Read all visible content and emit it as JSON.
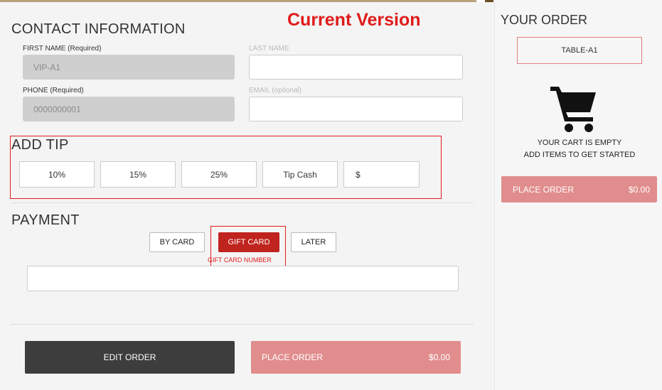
{
  "banner": {
    "version_label": "Current Version"
  },
  "contact": {
    "title": "CONTACT INFORMATION",
    "first_name": {
      "label": "FIRST NAME (Required)",
      "value": "VIP-A1"
    },
    "last_name": {
      "label": "LAST NAME",
      "value": ""
    },
    "phone": {
      "label": "PHONE (Required)",
      "value": "0000000001"
    },
    "email": {
      "label": "EMAIL (optional)",
      "value": ""
    }
  },
  "tip": {
    "title": "ADD TIP",
    "options": [
      "10%",
      "15%",
      "25%",
      "Tip Cash"
    ],
    "amount_prefix": "$"
  },
  "payment": {
    "title": "PAYMENT",
    "methods": [
      "BY CARD",
      "GIFT CARD",
      "LATER"
    ],
    "selected": "GIFT CARD",
    "gift_card_label": "GIFT CARD NUMBER",
    "gift_card_value": ""
  },
  "actions": {
    "edit_order": "EDIT ORDER",
    "place_order": "PLACE ORDER",
    "total": "$0.00"
  },
  "order": {
    "title": "YOUR ORDER",
    "table": "TABLE-A1",
    "cart_icon": "shopping-cart-icon",
    "empty_line1": "YOUR CART IS EMPTY",
    "empty_line2": "ADD ITEMS TO GET STARTED",
    "place_order": "PLACE ORDER",
    "total": "$0.00"
  },
  "colors": {
    "accent": "#c0241e",
    "place_order": "#e18d8d",
    "highlight": "#e01b1b",
    "dark_button": "#3d3d3d"
  }
}
